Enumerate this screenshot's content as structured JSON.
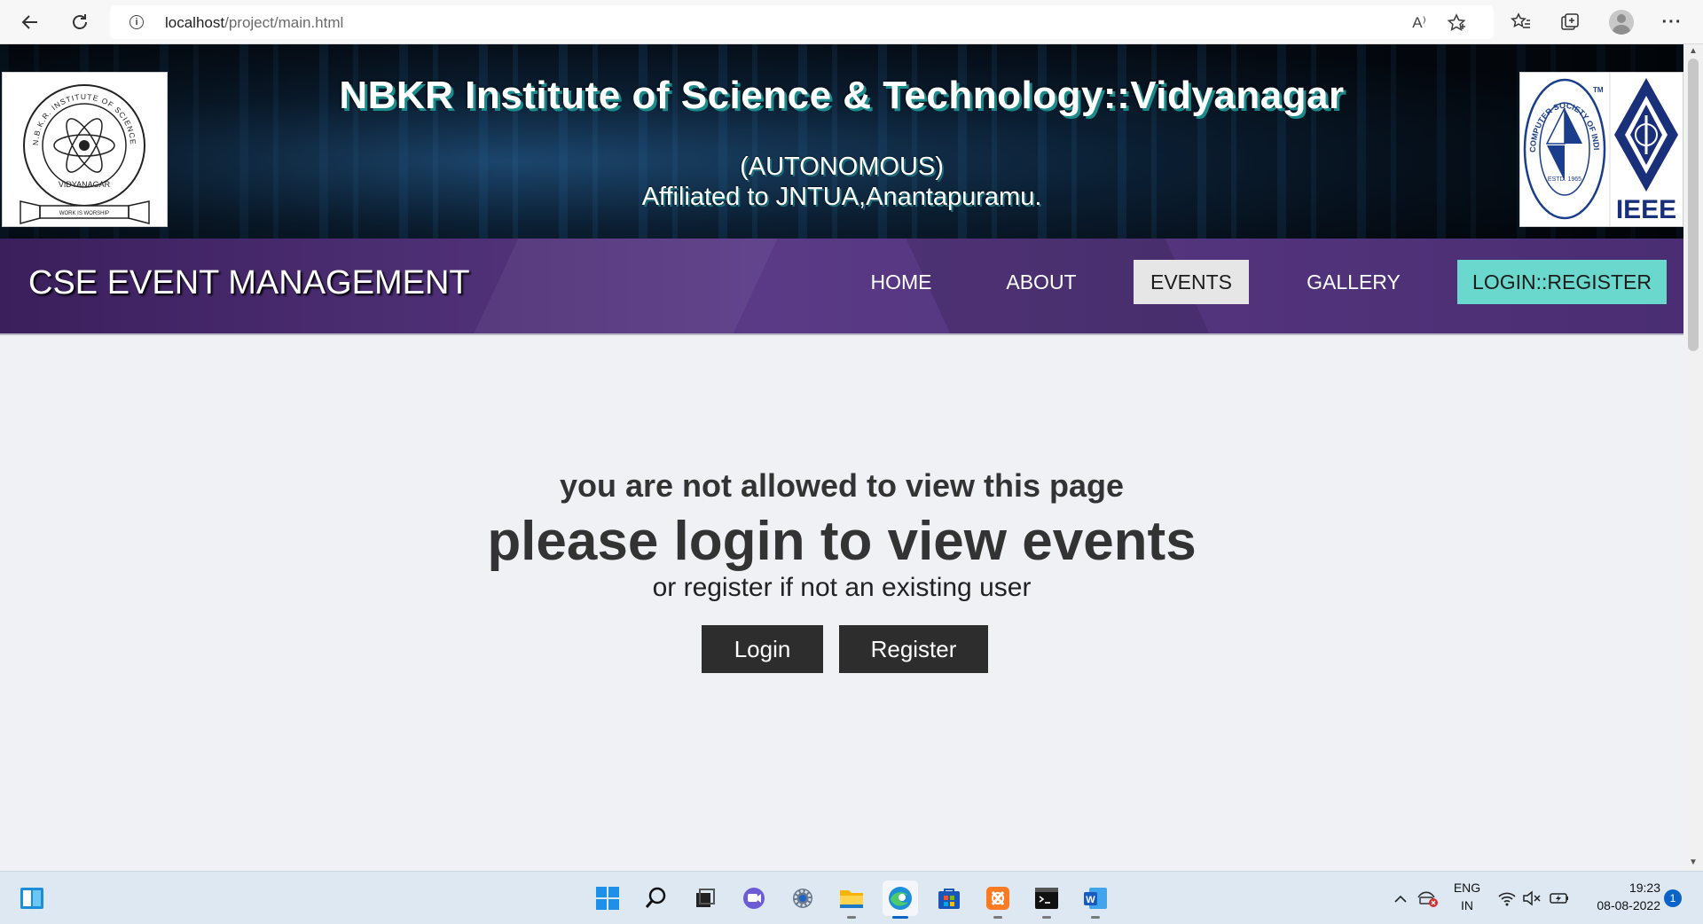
{
  "browser": {
    "url_host": "localhost",
    "url_path": "/project/main.html",
    "read_aloud_icon": "A⁾"
  },
  "header": {
    "title": "NBKR Institute of Science & Technology::Vidyanagar",
    "autonomous": "(AUTONOMOUS)",
    "affiliation": "Affiliated to JNTUA,Anantapuramu.",
    "logo_left": {
      "ring_text": "N.B.K.R. INSTITUTE OF SCIENCE AND TECHNOLOGY",
      "place": "VIDYANAGAR",
      "motto": "WORK IS WORSHIP"
    },
    "logo_csi": {
      "ring_text": "COMPUTER SOCIETY OF INDIA",
      "tm": "TM",
      "estd": "ESTD. 1965"
    },
    "logo_ieee": "IEEE"
  },
  "navbar": {
    "brand": "CSE EVENT MANAGEMENT",
    "items": [
      {
        "label": "HOME"
      },
      {
        "label": "ABOUT"
      },
      {
        "label": "EVENTS"
      },
      {
        "label": "GALLERY"
      },
      {
        "label": "LOGIN::REGISTER"
      }
    ]
  },
  "main": {
    "line1": "you are not allowed to view this page",
    "line2": "please login to view events",
    "line3": "or register if not an existing user",
    "login_label": "Login",
    "register_label": "Register"
  },
  "taskbar": {
    "language": "ENG",
    "region": "IN",
    "time": "19:23",
    "date": "08-08-2022",
    "notification_count": "1"
  },
  "colors": {
    "nav_bg": "#4a2d72",
    "active_nav": "#e6e6e6",
    "cta": "#6ad8cc",
    "button_bg": "#2d2d2d",
    "page_bg": "#f0f1f5"
  }
}
